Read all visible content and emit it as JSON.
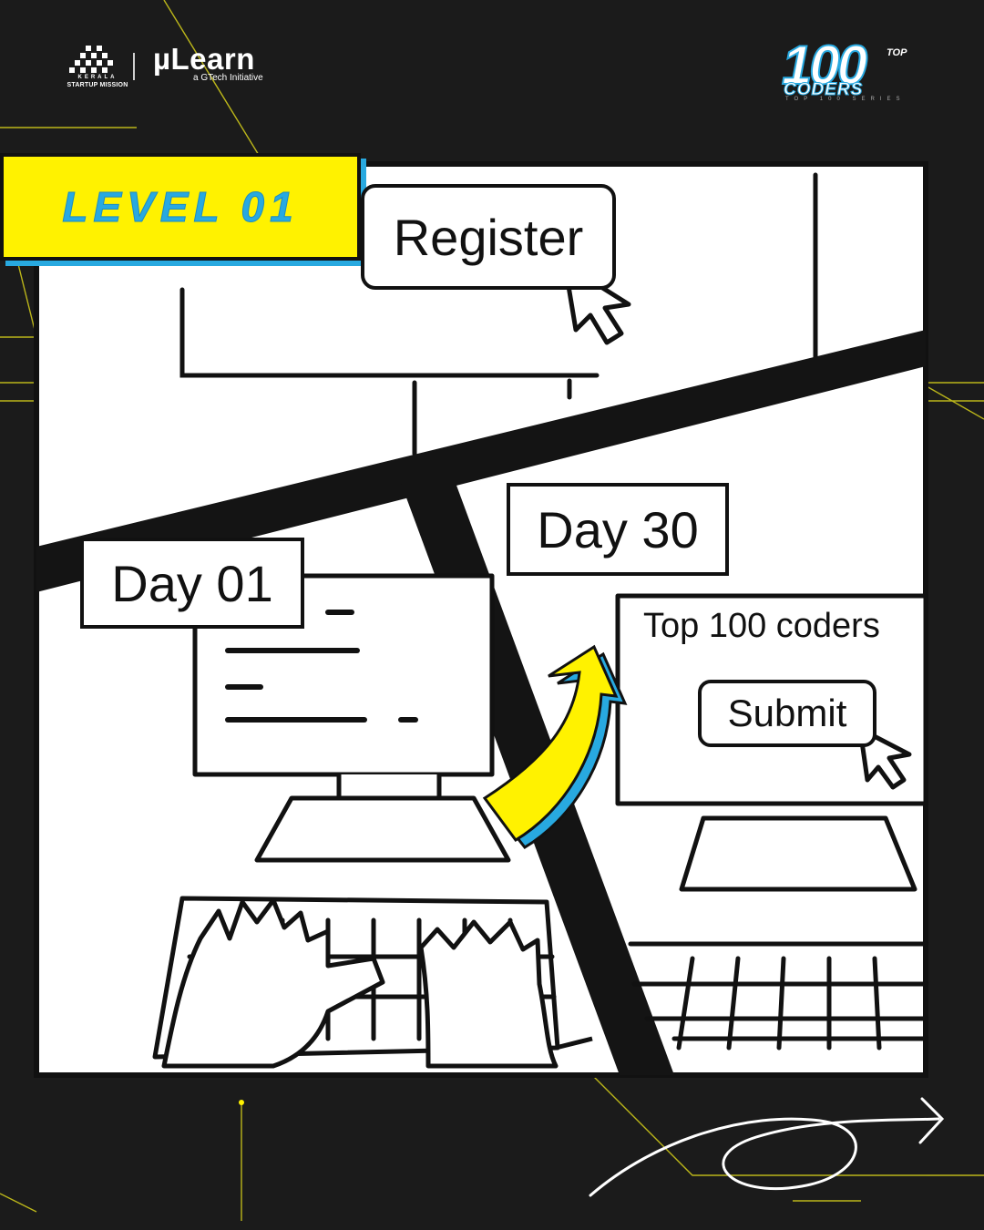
{
  "brand": {
    "ksum_line1": "KERALA",
    "ksum_line2": "STARTUP MISSION",
    "mulearn_name": "µLearn",
    "mulearn_tagline": "a GTech Initiative"
  },
  "badge": {
    "top": "TOP",
    "number": "100",
    "word": "CODERS",
    "series": "TOP 100 SERIES"
  },
  "level": {
    "label": "LEVEL 01"
  },
  "panels": {
    "register_label": "Register",
    "day_start": "Day 01",
    "day_end": "Day 30",
    "screen_text": "Top 100 coders",
    "submit_label": "Submit"
  },
  "colors": {
    "background": "#1b1b1b",
    "accent_yellow": "#fff200",
    "accent_blue": "#28a9e0",
    "panel": "#ffffff",
    "ink": "#111111"
  }
}
